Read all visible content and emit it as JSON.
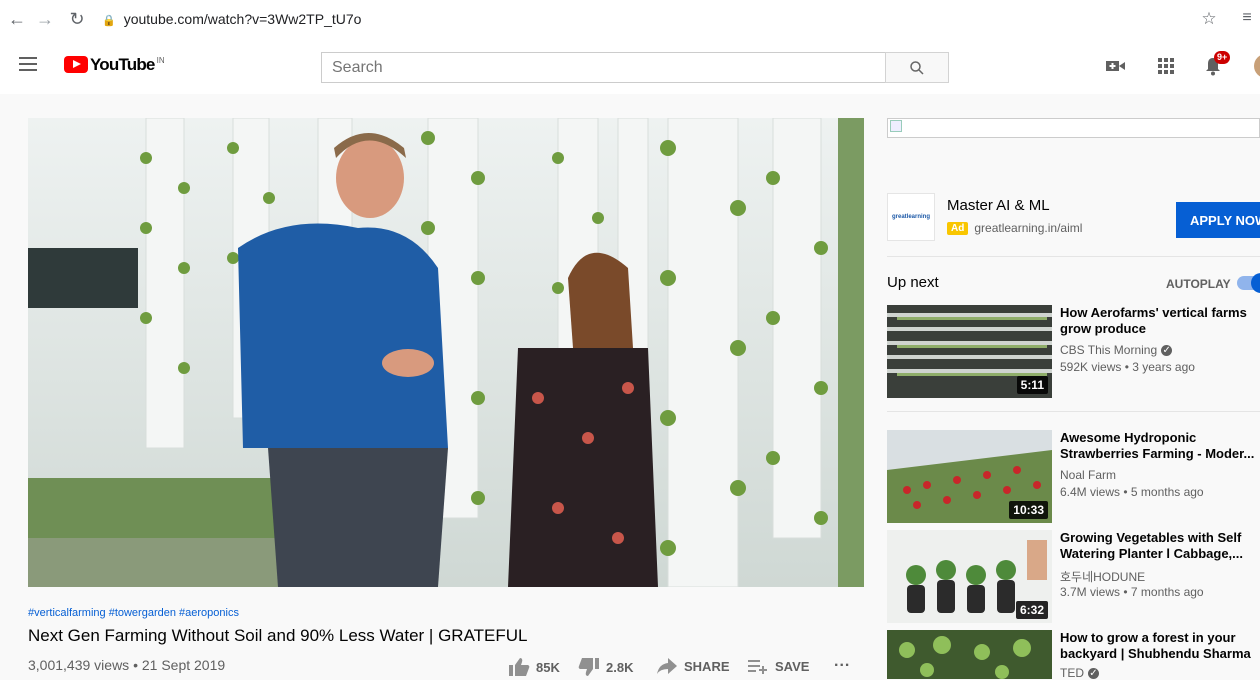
{
  "browser": {
    "url": "youtube.com/watch?v=3Ww2TP_tU7o"
  },
  "header": {
    "logo_text": "YouTube",
    "country": "IN",
    "search_placeholder": "Search",
    "notif_count": "9+"
  },
  "video": {
    "hashtags": "#verticalfarming #towergarden #aeroponics",
    "title": "Next Gen Farming Without Soil and 90% Less Water | GRATEFUL",
    "meta": "3,001,439 views • 21 Sept 2019",
    "likes": "85K",
    "dislikes": "2.8K",
    "share_label": "SHARE",
    "save_label": "SAVE",
    "more_label": "..."
  },
  "ad": {
    "logo_text": "greatlearning",
    "title": "Master AI & ML",
    "tag": "Ad",
    "url": "greatlearning.in/aiml",
    "cta": "APPLY NOW"
  },
  "upnext": {
    "label": "Up next",
    "autoplay": "AUTOPLAY",
    "autoplay_on": true
  },
  "recommendations": [
    {
      "title1": "How Aerofarms' vertical farms",
      "title2": "grow produce",
      "channel": "CBS This Morning",
      "verified": true,
      "stats": "592K views • 3 years ago",
      "duration": "5:11"
    },
    {
      "title1": "Awesome Hydroponic",
      "title2": "Strawberries Farming - Moder...",
      "channel": "Noal Farm",
      "verified": false,
      "stats": "6.4M views • 5 months ago",
      "duration": "10:33"
    },
    {
      "title1": "Growing Vegetables with Self",
      "title2": "Watering Planter l Cabbage,...",
      "channel": "호두네HODUNE",
      "verified": false,
      "stats": "3.7M views • 7 months ago",
      "duration": "6:32"
    },
    {
      "title1": "How to grow a forest in your",
      "title2": "backyard | Shubhendu Sharma",
      "channel": "TED",
      "verified": true,
      "stats": "",
      "duration": ""
    }
  ],
  "colors": {
    "youtube_red": "#ff0000",
    "link_blue": "#065fd4",
    "ad_yellow": "#f9c600"
  }
}
